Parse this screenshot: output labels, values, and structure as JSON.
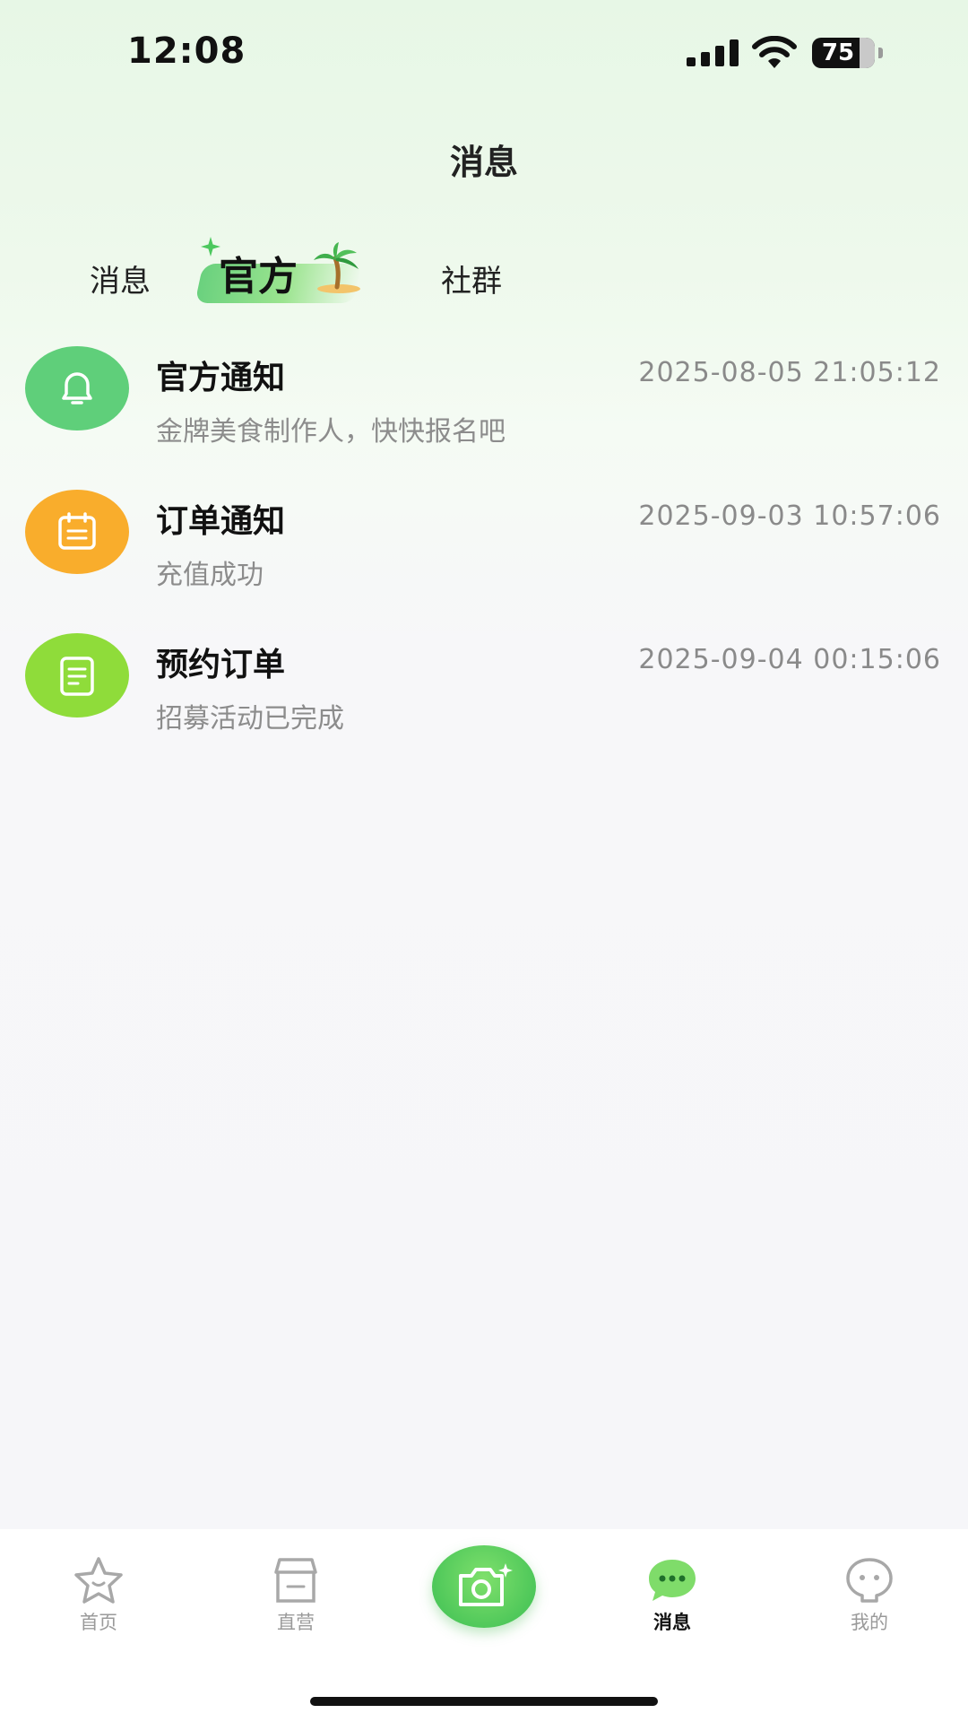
{
  "status_bar": {
    "time": "12:08",
    "battery_level": "75",
    "battery_fraction": 0.75
  },
  "nav": {
    "title": "消息"
  },
  "tabs": [
    {
      "label": "消息",
      "active": false
    },
    {
      "label": "官方",
      "active": true
    },
    {
      "label": "社群",
      "active": false
    }
  ],
  "messages": [
    {
      "title": "官方通知",
      "time": "2025-08-05 21:05:12",
      "subtitle": "金牌美食制作人，快快报名吧",
      "icon": "bell-icon",
      "color": "#5fcf7a"
    },
    {
      "title": "订单通知",
      "time": "2025-09-03 10:57:06",
      "subtitle": "充值成功",
      "icon": "calendar-icon",
      "color": "#f9ad2c"
    },
    {
      "title": "预约订单",
      "time": "2025-09-04 00:15:06",
      "subtitle": "招募活动已完成",
      "icon": "note-icon",
      "color": "#8fdc3a"
    }
  ],
  "tabbar": [
    {
      "label": "首页",
      "icon": "star-face-icon",
      "active": false
    },
    {
      "label": "直营",
      "icon": "store-icon",
      "active": false
    },
    {
      "label": "",
      "icon": "camera-sparkle-icon",
      "active": false
    },
    {
      "label": "消息",
      "icon": "chat-bubble-icon",
      "active": true
    },
    {
      "label": "我的",
      "icon": "profile-face-icon",
      "active": false
    }
  ],
  "colors": {
    "brand_green": "#5fcf7a",
    "orange": "#f9ad2c",
    "lime": "#8fdc3a"
  }
}
